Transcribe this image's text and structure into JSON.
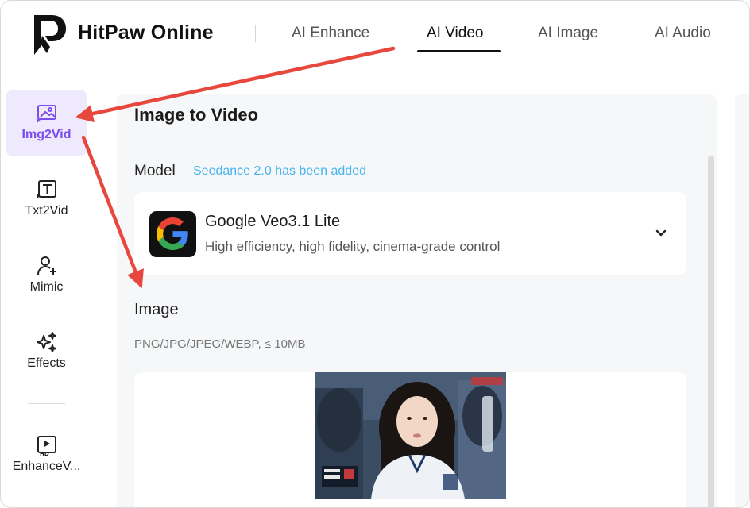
{
  "header": {
    "brand": "HitPaw Online",
    "tabs": [
      {
        "label": "AI Enhance",
        "active": false
      },
      {
        "label": "AI Video",
        "active": true
      },
      {
        "label": "AI Image",
        "active": false
      },
      {
        "label": "AI Audio",
        "active": false
      }
    ]
  },
  "sidebar": {
    "items": [
      {
        "label": "Img2Vid",
        "icon": "image-to-video-icon",
        "active": true
      },
      {
        "label": "Txt2Vid",
        "icon": "text-to-video-icon",
        "active": false
      },
      {
        "label": "Mimic",
        "icon": "user-sparkle-icon",
        "active": false
      },
      {
        "label": "Effects",
        "icon": "sparkles-icon",
        "active": false
      },
      {
        "label": "EnhanceV...",
        "icon": "hd-video-icon",
        "active": false
      }
    ]
  },
  "main": {
    "title": "Image to Video",
    "model_label": "Model",
    "model_note": "Seedance 2.0 has been added",
    "model": {
      "name": "Google Veo3.1 Lite",
      "description": "High efficiency, high fidelity, cinema-grade control",
      "icon": "google-g-icon"
    },
    "image_label": "Image",
    "image_hint": "PNG/JPG/JPEG/WEBP, ≤ 10MB"
  },
  "colors": {
    "accent": "#7b4cf0",
    "accent_bg": "#efe9fd",
    "note": "#46b4ef",
    "arrow": "#e8473e",
    "panel_bg": "#f6f7f9"
  }
}
